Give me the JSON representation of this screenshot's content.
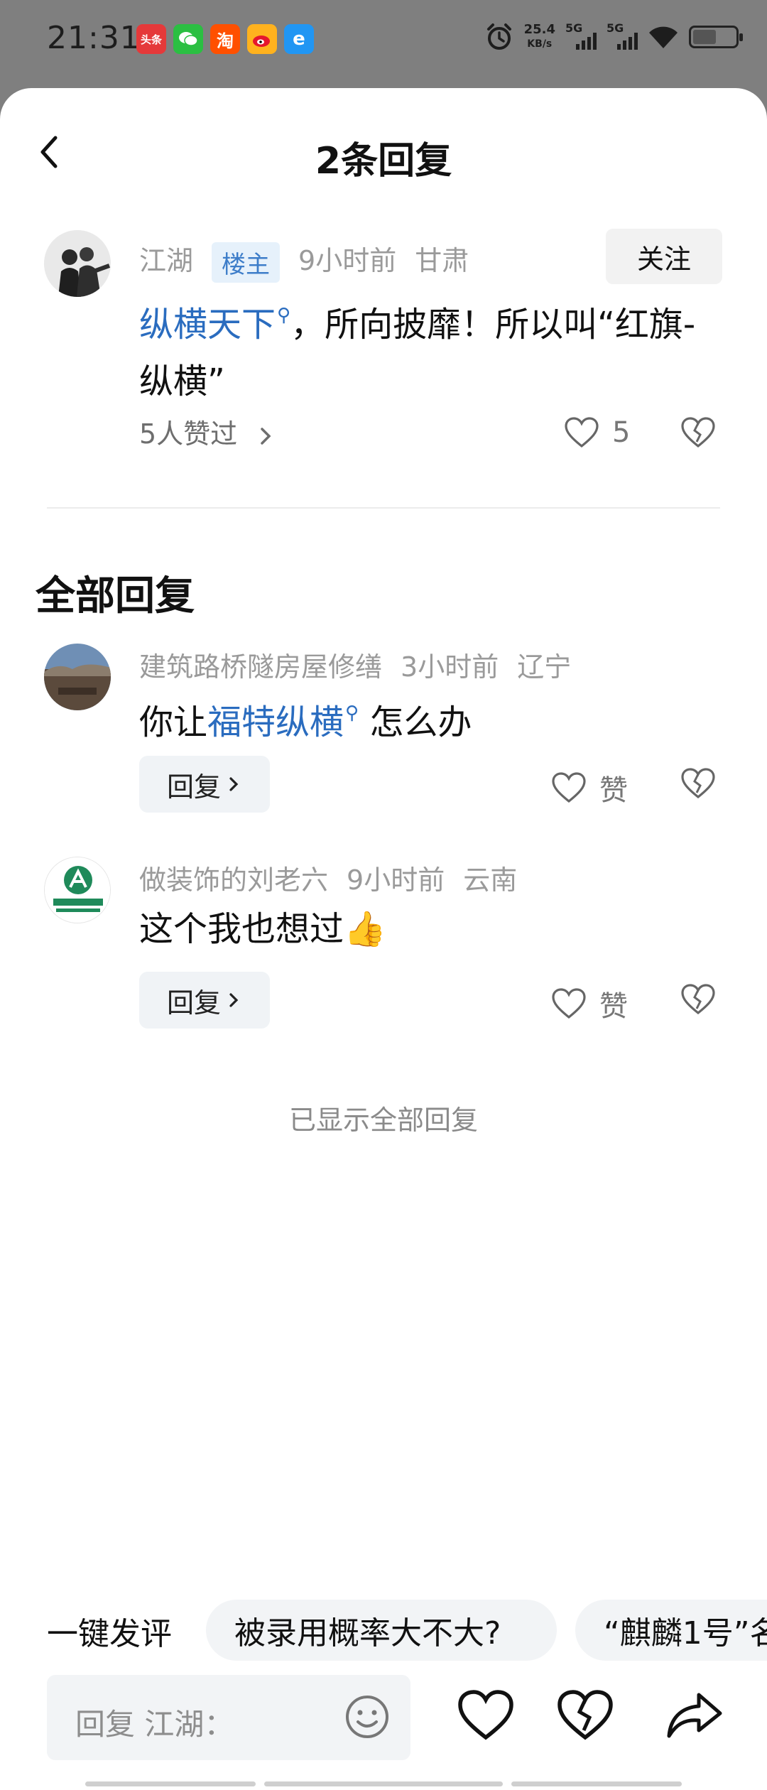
{
  "status_bar": {
    "time": "21:31",
    "apps": [
      {
        "name": "toutiao-app-icon",
        "label": "头条",
        "color": "#e5393a"
      },
      {
        "name": "wechat-app-icon",
        "label": "",
        "color": "#2bbf42"
      },
      {
        "name": "taobao-app-icon",
        "label": "淘",
        "color": "#ff5000"
      },
      {
        "name": "weibo-app-icon",
        "label": "",
        "color": "#ff9a1e"
      },
      {
        "name": "browser-app-icon",
        "label": "e",
        "color": "#2196f3"
      }
    ],
    "network_speed_value": "25.4",
    "network_speed_unit": "KB/s",
    "signal_1": "5G",
    "signal_2": "5G",
    "battery_level": 0.55
  },
  "header": {
    "title": "2条回复"
  },
  "main_comment": {
    "author": "江湖",
    "badge": "楼主",
    "time": "9小时前",
    "location": "甘肃",
    "follow_label": "关注",
    "link_text": "纵横天下",
    "text_after_link": "，所向披靡！所以叫“红旗-纵横”",
    "likers_text": "5人赞过",
    "like_count": "5"
  },
  "section_title": "全部回复",
  "replies": [
    {
      "author": "建筑路桥隧房屋修缮",
      "time": "3小时前",
      "location": "辽宁",
      "text_before_link": "你让",
      "link_text": "福特纵横",
      "text_after_link": " 怎么办",
      "reply_label": "回复",
      "like_label": "赞"
    },
    {
      "author": "做装饰的刘老六",
      "time": "9小时前",
      "location": "云南",
      "text": "这个我也想过",
      "emoji": "👍",
      "reply_label": "回复",
      "like_label": "赞"
    }
  ],
  "end_text": "已显示全部回复",
  "quick_comment": {
    "label": "一键发评",
    "chips": [
      "被录用概率大不大?",
      "“麒麟1号”名"
    ]
  },
  "input": {
    "placeholder": "回复 江湖："
  },
  "colors": {
    "link": "#2a6cbf",
    "badge_bg": "#e6f1fb",
    "badge_text": "#3d7dc9"
  }
}
